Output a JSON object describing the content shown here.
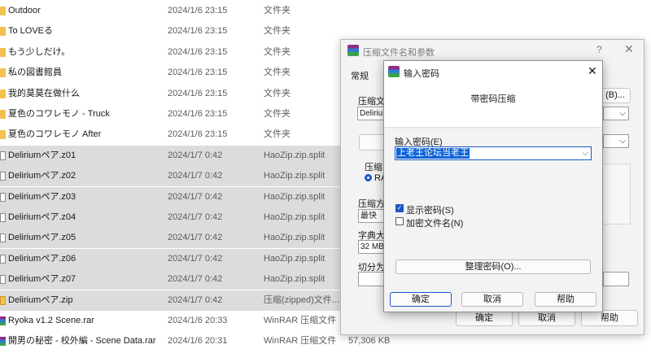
{
  "files": [
    {
      "name": "Outdoor",
      "date": "2024/1/6 23:15",
      "type": "文件夹",
      "size": "",
      "icon": "folder",
      "selected": false
    },
    {
      "name": "To LOVEる",
      "date": "2024/1/6 23:15",
      "type": "文件夹",
      "size": "",
      "icon": "folder",
      "selected": false
    },
    {
      "name": "もう少しだけ。",
      "date": "2024/1/6 23:15",
      "type": "文件夹",
      "size": "",
      "icon": "folder",
      "selected": false
    },
    {
      "name": "私の図書館員",
      "date": "2024/1/6 23:15",
      "type": "文件夹",
      "size": "",
      "icon": "folder",
      "selected": false
    },
    {
      "name": "我的莫莫在做什么",
      "date": "2024/1/6 23:15",
      "type": "文件夹",
      "size": "",
      "icon": "folder",
      "selected": false
    },
    {
      "name": "夏色のコワレモノ - Truck",
      "date": "2024/1/6 23:15",
      "type": "文件夹",
      "size": "",
      "icon": "folder",
      "selected": false
    },
    {
      "name": "夏色のコワレモノ After",
      "date": "2024/1/6 23:15",
      "type": "文件夹",
      "size": "",
      "icon": "folder",
      "selected": false
    },
    {
      "name": "Deliriumペア.z01",
      "date": "2024/1/7 0:42",
      "type": "HaoZip.zip.split",
      "size": "",
      "icon": "file",
      "selected": true
    },
    {
      "name": "Deliriumペア.z02",
      "date": "2024/1/7 0:42",
      "type": "HaoZip.zip.split",
      "size": "",
      "icon": "file",
      "selected": true
    },
    {
      "name": "Deliriumペア.z03",
      "date": "2024/1/7 0:42",
      "type": "HaoZip.zip.split",
      "size": "",
      "icon": "file",
      "selected": true
    },
    {
      "name": "Deliriumペア.z04",
      "date": "2024/1/7 0:42",
      "type": "HaoZip.zip.split",
      "size": "",
      "icon": "file",
      "selected": true
    },
    {
      "name": "Deliriumペア.z05",
      "date": "2024/1/7 0:42",
      "type": "HaoZip.zip.split",
      "size": "",
      "icon": "file",
      "selected": true
    },
    {
      "name": "Deliriumペア.z06",
      "date": "2024/1/7 0:42",
      "type": "HaoZip.zip.split",
      "size": "",
      "icon": "file",
      "selected": true
    },
    {
      "name": "Deliriumペア.z07",
      "date": "2024/1/7 0:42",
      "type": "HaoZip.zip.split",
      "size": "",
      "icon": "file",
      "selected": true
    },
    {
      "name": "Deliriumペア.zip",
      "date": "2024/1/7 0:42",
      "type": "压缩(zipped)文件...",
      "size": "",
      "icon": "zip",
      "selected": true
    },
    {
      "name": "Ryoka v1.2 Scene.rar",
      "date": "2024/1/6 20:33",
      "type": "WinRAR 压缩文件",
      "size": "",
      "icon": "rar",
      "selected": false
    },
    {
      "name": "開男の秘密 - 校外編 - Scene Data.rar",
      "date": "2024/1/6 20:31",
      "type": "WinRAR 压缩文件",
      "size": "57,306 KB",
      "icon": "rar",
      "selected": false
    }
  ],
  "archive_dialog": {
    "title": "压缩文件名和参数",
    "help": "?",
    "close": "✕",
    "tab_general": "常规",
    "label_archive_name": "压缩文",
    "archive_name_value": "Deliriu",
    "browse_button": "(B)...",
    "label_format": "压缩",
    "radio_rar": "RA",
    "label_method": "压缩方",
    "method_value": "最快",
    "label_dict": "字典大",
    "dict_value": "32 MB",
    "label_split": "切分为",
    "ok": "确定",
    "cancel": "取消",
    "help_button": "帮助"
  },
  "password_dialog": {
    "title": "输入密码",
    "close": "✕",
    "heading": "带密码压缩",
    "label_password": "输入密码(E)",
    "password_value": "上老王论坛当老王",
    "show_password": "显示密码(S)",
    "show_password_checked": true,
    "encrypt_names": "加密文件名(N)",
    "encrypt_names_checked": false,
    "organize_button": "整理密码(O)...",
    "ok": "确定",
    "cancel": "取消",
    "help": "帮助"
  }
}
